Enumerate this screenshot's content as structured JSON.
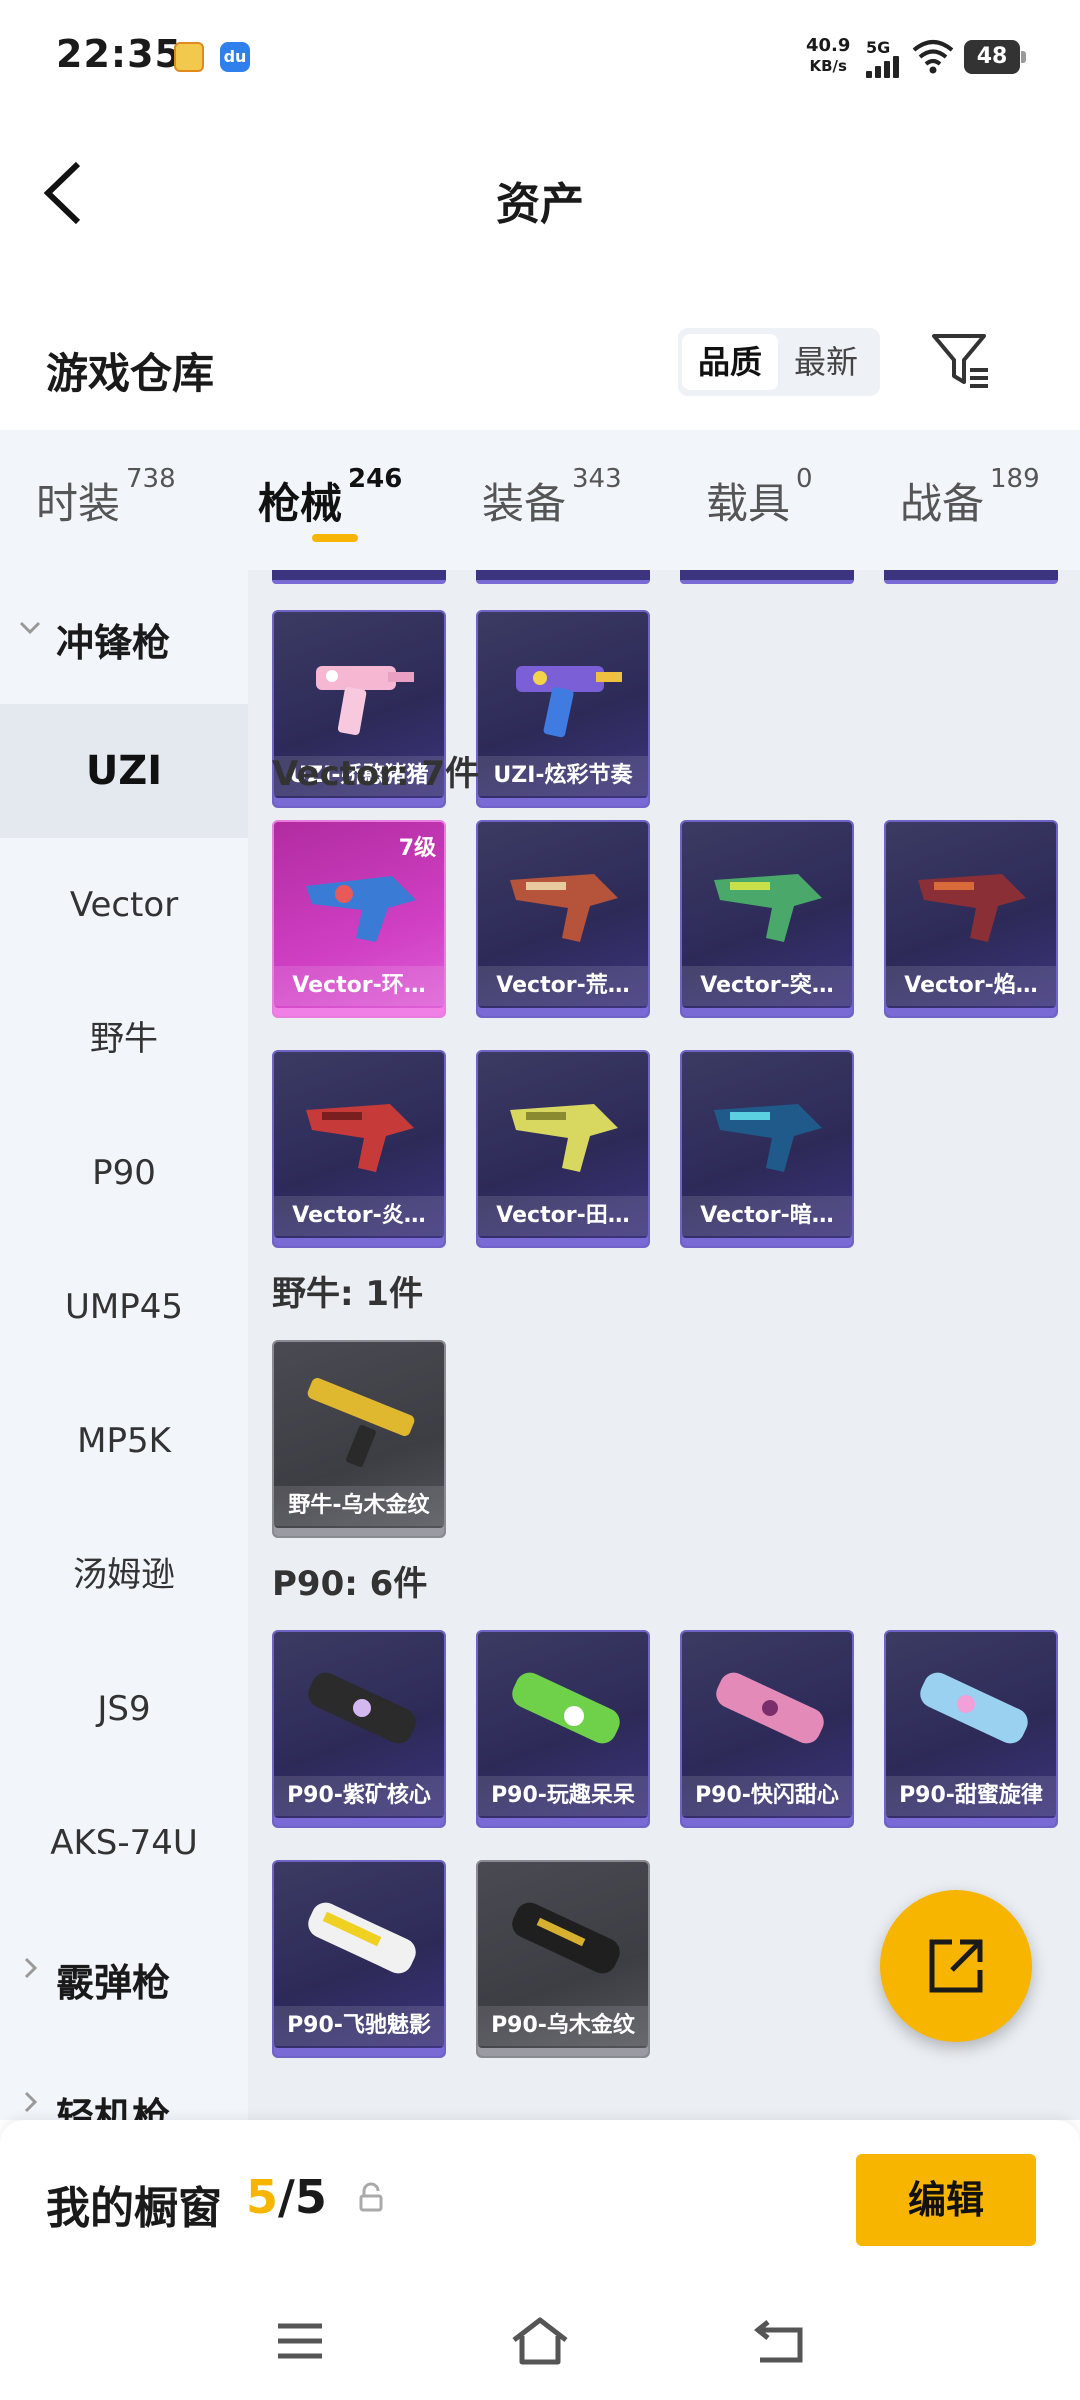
{
  "status_bar": {
    "time": "22:35",
    "net_speed_value": "40.9",
    "net_speed_unit": "KB/s",
    "network": "5G",
    "battery": "48"
  },
  "header": {
    "title": "资产"
  },
  "warehouse": {
    "title": "游戏仓库",
    "sort_options": [
      {
        "label": "品质",
        "active": true
      },
      {
        "label": "最新",
        "active": false
      }
    ]
  },
  "category_tabs": [
    {
      "label": "时装",
      "count": "738"
    },
    {
      "label": "枪械",
      "count": "246",
      "active": true
    },
    {
      "label": "装备",
      "count": "343"
    },
    {
      "label": "载具",
      "count": "0"
    },
    {
      "label": "战备",
      "count": "189"
    }
  ],
  "sidebar": {
    "group_smg": "冲锋枪",
    "items": [
      "UZI",
      "Vector",
      "野牛",
      "P90",
      "UMP45",
      "MP5K",
      "汤姆逊",
      "JS9",
      "AKS-74U"
    ],
    "active_item": "UZI",
    "group_shotgun": "霰弹枪",
    "group_lmg": "轻机枪"
  },
  "sections": {
    "uzi": {
      "items": [
        {
          "name": "UZI-娇憨猪猪"
        },
        {
          "name": "UZI-炫彩节奏"
        }
      ]
    },
    "vector": {
      "header": "Vector: 7件",
      "items": [
        {
          "name": "Vector-环…",
          "level": "7级"
        },
        {
          "name": "Vector-荒…"
        },
        {
          "name": "Vector-突…"
        },
        {
          "name": "Vector-焰…"
        },
        {
          "name": "Vector-炎…"
        },
        {
          "name": "Vector-田…"
        },
        {
          "name": "Vector-暗…"
        }
      ]
    },
    "bison": {
      "header": "野牛: 1件",
      "items": [
        {
          "name": "野牛-乌木金纹"
        }
      ]
    },
    "p90": {
      "header": "P90: 6件",
      "items": [
        {
          "name": "P90-紫矿核心"
        },
        {
          "name": "P90-玩趣呆呆"
        },
        {
          "name": "P90-快闪甜心"
        },
        {
          "name": "P90-甜蜜旋律"
        },
        {
          "name": "P90-飞驰魅影"
        },
        {
          "name": "P90-乌木金纹"
        }
      ]
    }
  },
  "showcase": {
    "title": "我的橱窗",
    "current": "5",
    "separator": "/",
    "total": "5",
    "edit_label": "编辑"
  },
  "icons": [
    "back-icon",
    "filter-icon",
    "chevron-down-icon",
    "chevron-right-icon",
    "share-icon",
    "lock-icon",
    "menu-icon",
    "home-icon",
    "return-icon"
  ],
  "colors": {
    "accent": "#f7b500",
    "card_purple": "#2d2a58",
    "card_pink": "#d03fc4",
    "card_gray": "#3d3d44"
  }
}
